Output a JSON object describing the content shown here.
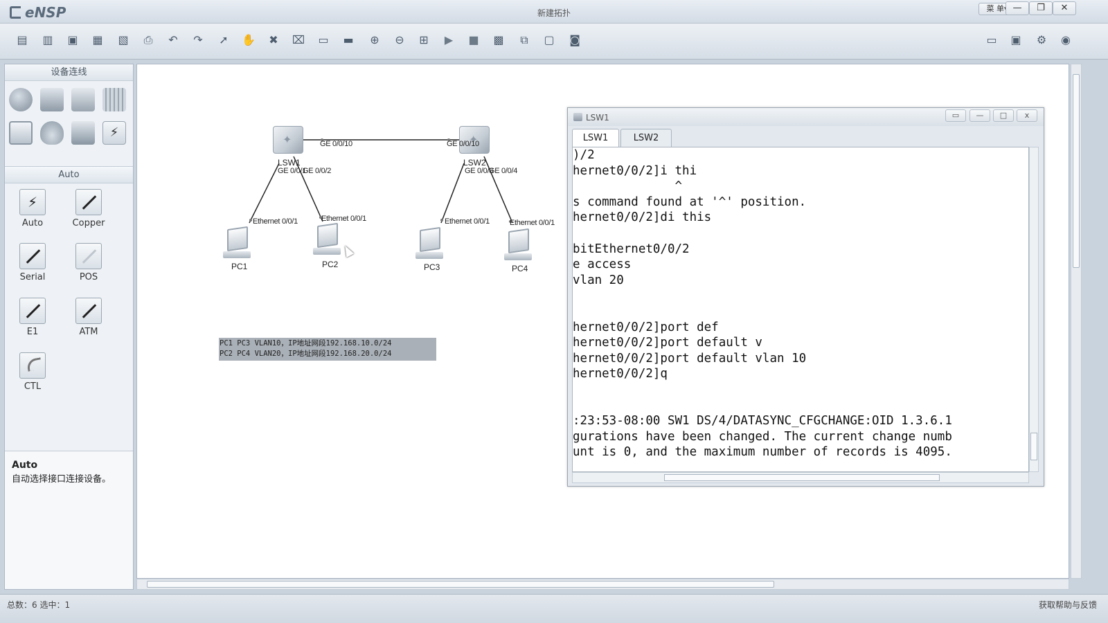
{
  "app": {
    "name": "eNSP",
    "window_title": "新建拓扑",
    "menu_label": "菜 单▾"
  },
  "window_controls": {
    "minimize": "—",
    "restore": "❐",
    "close": "✕"
  },
  "toolbar_icons": [
    "new-topology",
    "open",
    "save",
    "save-as",
    "save-image",
    "print",
    "undo",
    "redo",
    "select",
    "hand",
    "delete",
    "delete-links",
    "text",
    "rectangle",
    "zoom-in",
    "zoom-out",
    "fit",
    "start",
    "stop",
    "capture",
    "topology",
    "console",
    "snapshot"
  ],
  "left_panel": {
    "device_header": "设备连线",
    "cable_header": "Auto",
    "cables": [
      {
        "label": "Auto"
      },
      {
        "label": "Copper"
      },
      {
        "label": "Serial"
      },
      {
        "label": "POS"
      },
      {
        "label": "E1"
      },
      {
        "label": "ATM"
      },
      {
        "label": "CTL"
      }
    ],
    "help": {
      "title": "Auto",
      "text": "自动选择接口连接设备。"
    }
  },
  "topology": {
    "nodes": {
      "lsw1": "LSW1",
      "lsw2": "LSW2",
      "pc1": "PC1",
      "pc2": "PC2",
      "pc3": "PC3",
      "pc4": "PC4"
    },
    "ports": {
      "lsw1_ge10": "GE 0/0/10",
      "lsw2_ge10": "GE 0/0/10",
      "lsw1_ge1": "GE 0/0/1",
      "lsw1_ge2": "GE 0/0/2",
      "lsw2_ge3": "GE 0/0/3",
      "lsw2_ge4": "GE 0/0/4",
      "pc1_eth": "Ethernet 0/0/1",
      "pc2_eth": "Ethernet 0/0/1",
      "pc3_eth": "Ethernet 0/0/1",
      "pc4_eth": "Ethernet 0/0/1"
    },
    "note_lines": [
      "PC1 PC3 VLAN10，IP地址网段192.168.10.0/24",
      "PC2 PC4 VLAN20，IP地址网段192.168.20.0/24"
    ]
  },
  "console": {
    "title": "LSW1",
    "tabs": [
      "LSW1",
      "LSW2"
    ],
    "active_tab": "LSW1",
    "lines": [
      ")/2",
      "hernet0/0/2]i thi",
      "              ^",
      "s command found at '^' position.",
      "hernet0/0/2]di this",
      "",
      "bitEthernet0/0/2",
      "e access",
      "vlan 20",
      "",
      "",
      "hernet0/0/2]port def",
      "hernet0/0/2]port default v",
      "hernet0/0/2]port default vlan 10",
      "hernet0/0/2]q",
      "",
      "",
      ":23:53-08:00 SW1 DS/4/DATASYNC_CFGCHANGE:OID 1.3.6.1",
      "gurations have been changed. The current change numb",
      "unt is 0, and the maximum number of records is 4095."
    ]
  },
  "statusbar": {
    "left": "总数：6 选中：1",
    "right": "获取帮助与反馈"
  }
}
